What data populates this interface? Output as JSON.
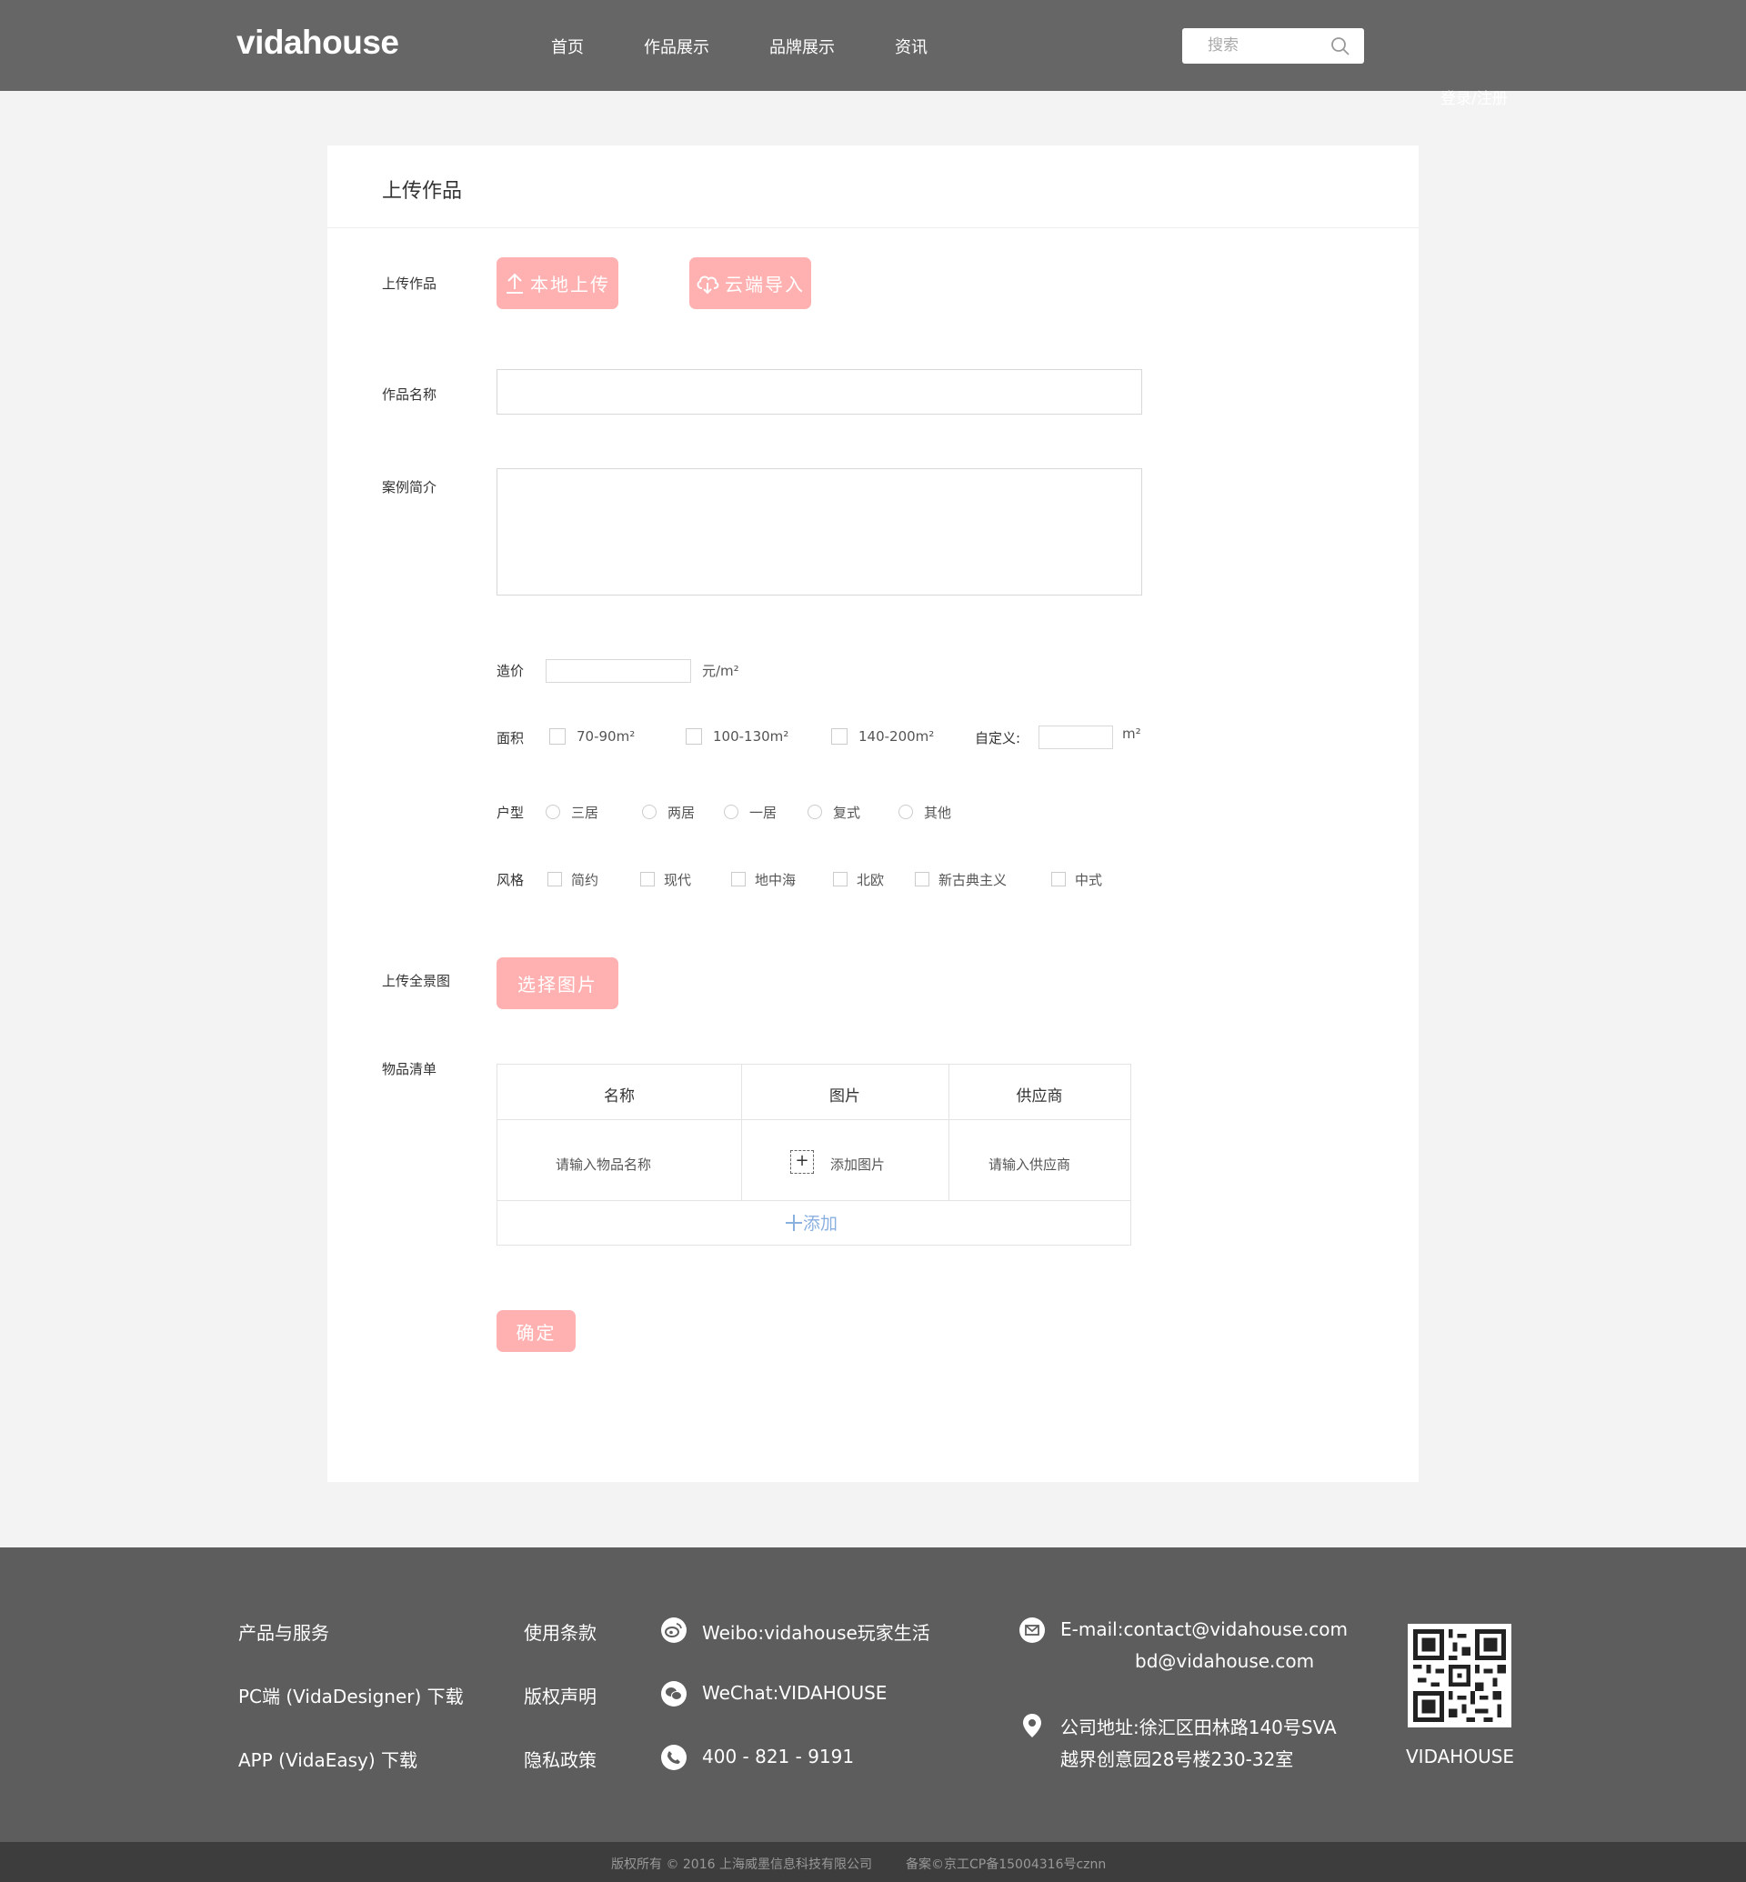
{
  "header": {
    "logo": "vidahouse",
    "nav": [
      "首页",
      "作品展示",
      "品牌展示",
      "资讯"
    ],
    "search_placeholder": "搜索",
    "login": "登录/注册"
  },
  "card": {
    "title": "上传作品",
    "upload_label": "上传作品",
    "local_upload": "本地上传",
    "cloud_import": "云端导入",
    "name_label": "作品名称",
    "intro_label": "案例简介",
    "price_label": "造价",
    "price_unit": "元/m²",
    "area_label": "面积",
    "area_options": [
      "70-90m²",
      "100-130m²",
      "140-200m²"
    ],
    "custom_label": "自定义:",
    "custom_unit": "m²",
    "type_label": "户型",
    "type_options": [
      "三居",
      "两居",
      "一居",
      "复式",
      "其他"
    ],
    "style_label": "风格",
    "style_options": [
      "简约",
      "现代",
      "地中海",
      "北欧",
      "新古典主义",
      "中式"
    ],
    "panorama_label": "上传全景图",
    "choose_image": "选择图片",
    "list_label": "物品清单",
    "table": {
      "headers": [
        "名称",
        "图片",
        "供应商"
      ],
      "name_placeholder": "请输入物品名称",
      "add_image": "添加图片",
      "supplier_placeholder": "请输入供应商",
      "add_row": "添加"
    },
    "confirm": "确定"
  },
  "footer": {
    "col1": [
      "产品与服务",
      "PC端 (VidaDesigner) 下载",
      "APP (VidaEasy) 下载"
    ],
    "col2": [
      "使用条款",
      "版权声明",
      "隐私政策"
    ],
    "weibo": "Weibo:vidahouse玩家生活",
    "wechat": "WeChat:VIDAHOUSE",
    "phone": "400 - 821 - 9191",
    "email_line1": "E-mail:contact@vidahouse.com",
    "email_line2": "bd@vidahouse.com",
    "address_line1": "公司地址:徐汇区田林路140号SVA",
    "address_line2": "越界创意园28号楼230-32室",
    "qr_label": "VIDAHOUSE",
    "copyright": "版权所有 © 2016 上海威墨信息科技有限公司",
    "icp": "备案©京工CP备15004316号cznn"
  },
  "colors": {
    "header_bg": "#666666",
    "accent_pink": "#ffb1b1",
    "footer_bg": "#5d5d5d",
    "bottom_bar": "#3d3d3d",
    "add_link": "#8ab0e0"
  }
}
